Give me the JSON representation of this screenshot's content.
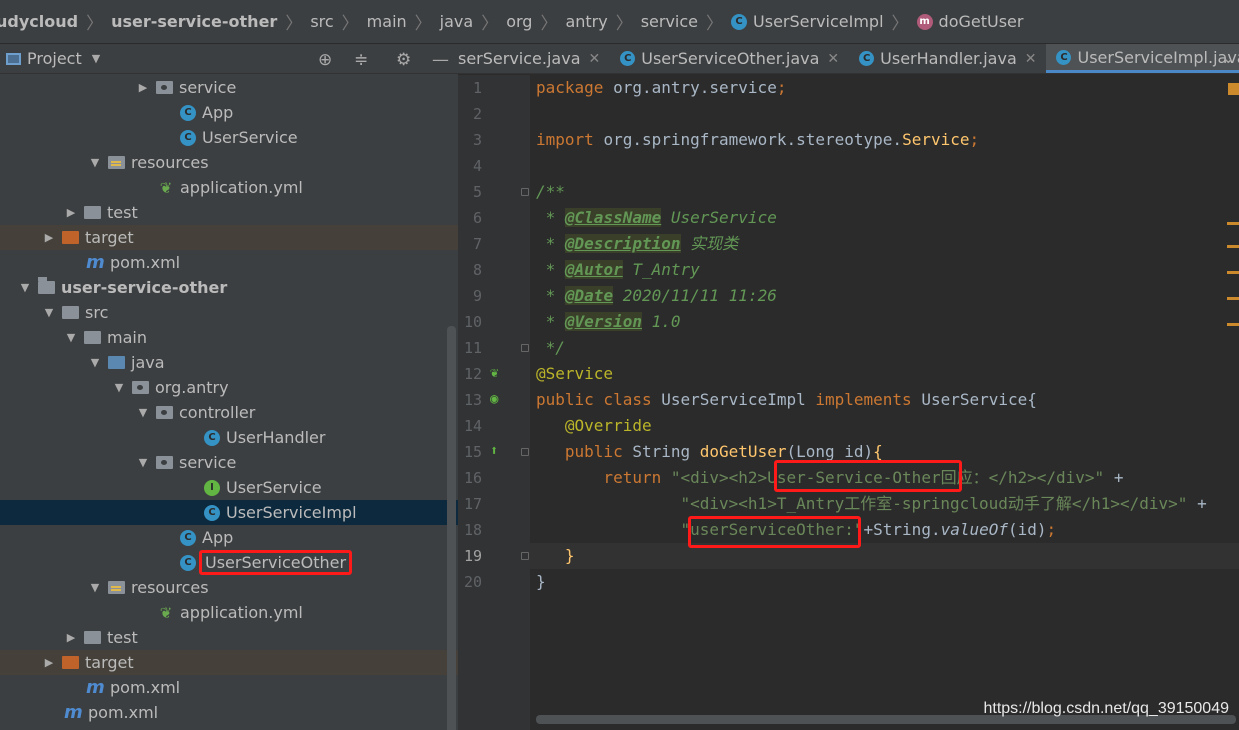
{
  "breadcrumb": [
    "udycloud",
    "user-service-other",
    "src",
    "main",
    "java",
    "org",
    "antry",
    "service",
    "UserServiceImpl",
    "doGetUser"
  ],
  "project_pane": {
    "title": "Project",
    "tree": [
      {
        "label": "service",
        "depth": 5,
        "icon": "package-folder",
        "arrow": "right"
      },
      {
        "label": "App",
        "depth": 6,
        "icon": "class-run"
      },
      {
        "label": "UserService",
        "depth": 6,
        "icon": "class-spring"
      },
      {
        "label": "resources",
        "depth": 3,
        "icon": "resources-folder",
        "arrow": "down"
      },
      {
        "label": "application.yml",
        "depth": 5,
        "icon": "yaml-spring"
      },
      {
        "label": "test",
        "depth": 2,
        "icon": "folder",
        "arrow": "right"
      },
      {
        "label": "target",
        "depth": 1,
        "icon": "target-folder",
        "arrow": "right"
      },
      {
        "label": "pom.xml",
        "depth": 2,
        "icon": "maven-m"
      },
      {
        "label": "user-service-other",
        "depth": 0,
        "icon": "module-folder",
        "arrow": "down",
        "bold": true
      },
      {
        "label": "src",
        "depth": 1,
        "icon": "folder",
        "arrow": "down"
      },
      {
        "label": "main",
        "depth": 2,
        "icon": "folder",
        "arrow": "down"
      },
      {
        "label": "java",
        "depth": 3,
        "icon": "source-folder",
        "arrow": "down"
      },
      {
        "label": "org.antry",
        "depth": 4,
        "icon": "package-folder",
        "arrow": "down"
      },
      {
        "label": "controller",
        "depth": 5,
        "icon": "package-folder",
        "arrow": "down"
      },
      {
        "label": "UserHandler",
        "depth": 7,
        "icon": "class"
      },
      {
        "label": "service",
        "depth": 5,
        "icon": "package-folder",
        "arrow": "down"
      },
      {
        "label": "UserService",
        "depth": 7,
        "icon": "interface"
      },
      {
        "label": "UserServiceImpl",
        "depth": 7,
        "icon": "class",
        "selected": true
      },
      {
        "label": "App",
        "depth": 6,
        "icon": "class-run"
      },
      {
        "label": "UserServiceOther",
        "depth": 6,
        "icon": "class-spring",
        "highlighted": true
      },
      {
        "label": "resources",
        "depth": 3,
        "icon": "resources-folder",
        "arrow": "down"
      },
      {
        "label": "application.yml",
        "depth": 5,
        "icon": "yaml-spring"
      },
      {
        "label": "test",
        "depth": 2,
        "icon": "folder",
        "arrow": "right"
      },
      {
        "label": "target",
        "depth": 1,
        "icon": "target-folder",
        "arrow": "right"
      },
      {
        "label": "pom.xml",
        "depth": 2,
        "icon": "maven-m"
      },
      {
        "label": "pom.xml",
        "depth": 1,
        "icon": "maven-m"
      }
    ]
  },
  "tabs": [
    {
      "label": "serService.java",
      "icon": "",
      "active": false
    },
    {
      "label": "UserServiceOther.java",
      "icon": "class",
      "active": false
    },
    {
      "label": "UserHandler.java",
      "icon": "class",
      "active": false
    },
    {
      "label": "UserServiceImpl.java",
      "icon": "class",
      "active": true
    }
  ],
  "editor": {
    "current_line": 19,
    "lines": [
      {
        "n": 1,
        "code": [
          [
            "kw",
            "package "
          ],
          [
            "",
            "org.antry.service"
          ],
          [
            "kw",
            ";"
          ]
        ]
      },
      {
        "n": 2,
        "code": []
      },
      {
        "n": 3,
        "code": [
          [
            "kw",
            "import "
          ],
          [
            "",
            "org.springframework.stereotype."
          ],
          [
            "cls",
            "Service"
          ],
          [
            "kw",
            ";"
          ]
        ]
      },
      {
        "n": 4,
        "code": []
      },
      {
        "n": 5,
        "code": [
          [
            "doc",
            "/**"
          ]
        ]
      },
      {
        "n": 6,
        "code": [
          [
            "doc",
            " * "
          ],
          [
            "tag",
            "@ClassName"
          ],
          [
            "doc",
            " UserService"
          ]
        ]
      },
      {
        "n": 7,
        "code": [
          [
            "doc",
            " * "
          ],
          [
            "tag",
            "@Description"
          ],
          [
            "doc",
            " 实现类"
          ]
        ]
      },
      {
        "n": 8,
        "code": [
          [
            "doc",
            " * "
          ],
          [
            "tag",
            "@Autor"
          ],
          [
            "doc",
            " T_Antry"
          ]
        ]
      },
      {
        "n": 9,
        "code": [
          [
            "doc",
            " * "
          ],
          [
            "tag",
            "@Date"
          ],
          [
            "doc",
            " 2020/11/11 11:26"
          ]
        ]
      },
      {
        "n": 10,
        "code": [
          [
            "doc",
            " * "
          ],
          [
            "tag",
            "@Version"
          ],
          [
            "doc",
            " 1.0"
          ]
        ]
      },
      {
        "n": 11,
        "code": [
          [
            "doc",
            " */"
          ]
        ]
      },
      {
        "n": 12,
        "code": [
          [
            "ann",
            "@Service"
          ]
        ]
      },
      {
        "n": 13,
        "code": [
          [
            "kw",
            "public class "
          ],
          [
            "",
            "UserServiceImpl "
          ],
          [
            "kw",
            "implements "
          ],
          [
            "",
            "UserService{"
          ]
        ]
      },
      {
        "n": 14,
        "code": [
          [
            "ann",
            "   @Override"
          ]
        ]
      },
      {
        "n": 15,
        "code": [
          [
            "kw",
            "   public "
          ],
          [
            "",
            "String "
          ],
          [
            "fn",
            "doGetUser"
          ],
          [
            "",
            "(Long id)"
          ],
          [
            "fn",
            "{"
          ]
        ]
      },
      {
        "n": 16,
        "code": [
          [
            "kw",
            "       return "
          ],
          [
            "str",
            "\"<div><h2>User-Service-Other回应：</h2></div>\""
          ],
          [
            "",
            " +"
          ]
        ]
      },
      {
        "n": 17,
        "code": [
          [
            "str",
            "               \"<div><h1>T_Antry工作室-springcloud动手了解</h1></div>\""
          ],
          [
            "",
            " +"
          ]
        ]
      },
      {
        "n": 18,
        "code": [
          [
            "str",
            "               \"userServiceOther:\""
          ],
          [
            "",
            "+String."
          ],
          [
            "ital",
            "valueOf"
          ],
          [
            "",
            "(id)"
          ],
          [
            "kw",
            ";"
          ]
        ]
      },
      {
        "n": 19,
        "code": [
          [
            "fn",
            "   }"
          ]
        ]
      },
      {
        "n": 20,
        "code": [
          [
            "",
            "}"
          ]
        ]
      }
    ]
  },
  "watermark": "https://blog.csdn.net/qq_39150049"
}
